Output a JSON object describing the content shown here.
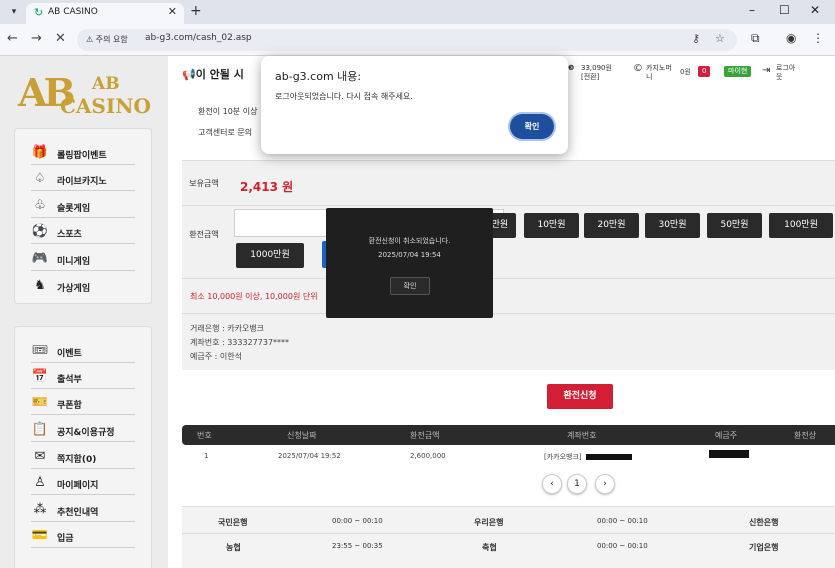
{
  "browser": {
    "tab_title": "AB CASINO",
    "new_tab": "+",
    "security_chip": "주의 요함",
    "url": "ab-g3.com/cash_02.asp"
  },
  "logo": {
    "mark": "AB",
    "line1": "AB",
    "line2": "CASINO"
  },
  "sidebar": {
    "games": [
      {
        "label": "롤링팝이벤트",
        "icon": "gift-icon"
      },
      {
        "label": "라이브카지노",
        "icon": "spade-icon"
      },
      {
        "label": "슬롯게임",
        "icon": "club-icon"
      },
      {
        "label": "스포츠",
        "icon": "soccer-ball-icon"
      },
      {
        "label": "미니게임",
        "icon": "gamepad-icon"
      },
      {
        "label": "가상게임",
        "icon": "horse-icon"
      }
    ],
    "account": [
      {
        "label": "이벤트",
        "icon": "event-icon"
      },
      {
        "label": "출석부",
        "icon": "calendar-icon"
      },
      {
        "label": "쿠폰함",
        "icon": "coupon-icon"
      },
      {
        "label": "공지&이용규정",
        "icon": "notice-icon"
      },
      {
        "label": "쪽지함(0)",
        "icon": "mail-icon"
      },
      {
        "label": "마이페이지",
        "icon": "user-icon"
      },
      {
        "label": "추천인내역",
        "icon": "referral-icon"
      },
      {
        "label": "입금",
        "icon": "deposit-icon"
      }
    ]
  },
  "header": {
    "marquee": "이 안될 시",
    "points": "33,090원",
    "points_sub": "[전환]",
    "casino_money": "카지노머니",
    "casino_money_val": "0원",
    "badge_red": "0",
    "badge_green": "마이현",
    "logout": "로그아웃"
  },
  "notices": [
    "환전이 10분 이상",
    "고객센터로 문의"
  ],
  "withdraw": {
    "balance_label": "보유금액",
    "balance_value": "2,413 원",
    "amount_label": "환전금액",
    "amount_buttons": [
      "1만원",
      "10만원",
      "20만원",
      "30만원",
      "50만원",
      "100만원"
    ],
    "amount_button_1000": "1000만원",
    "reset_label": "정",
    "min_note": "최소 10,000원 이상, 10,000원 단위",
    "bank_line": "거래은행 : 카카오뱅크",
    "account_line": "계좌번호 : 333327737****",
    "holder_line": "예금주 : 이한석",
    "submit": "환전신청"
  },
  "history": {
    "columns": [
      "번호",
      "신청날짜",
      "환전금액",
      "계좌번호",
      "예금주",
      "환전상"
    ],
    "rows": [
      {
        "no": "1",
        "date": "2025/07/04 19:52",
        "amount": "2,600,000",
        "account": "[카카오뱅크]"
      }
    ],
    "prev": "‹",
    "page": "1",
    "next": "›"
  },
  "banks": {
    "row1": [
      "국민은행",
      "00:00 ~ 00:10",
      "우리은행",
      "00:00 ~ 00:10",
      "신한은행"
    ],
    "row2": [
      "농협",
      "23:55 ~ 00:35",
      "축협",
      "00:00 ~ 00:10",
      "기업은행"
    ]
  },
  "toast": {
    "line1": "환전신청이 취소되었습니다.",
    "line2": "2025/07/04 19:54",
    "ok": "확인"
  },
  "alert": {
    "title": "ab-g3.com 내용:",
    "message": "로그아웃되었습니다. 다시 접속 해주세요.",
    "ok": "확인"
  },
  "colors": {
    "brand_gold": "#c8a036",
    "accent_red": "#d21f35",
    "dialog_blue": "#1e4f9e"
  }
}
